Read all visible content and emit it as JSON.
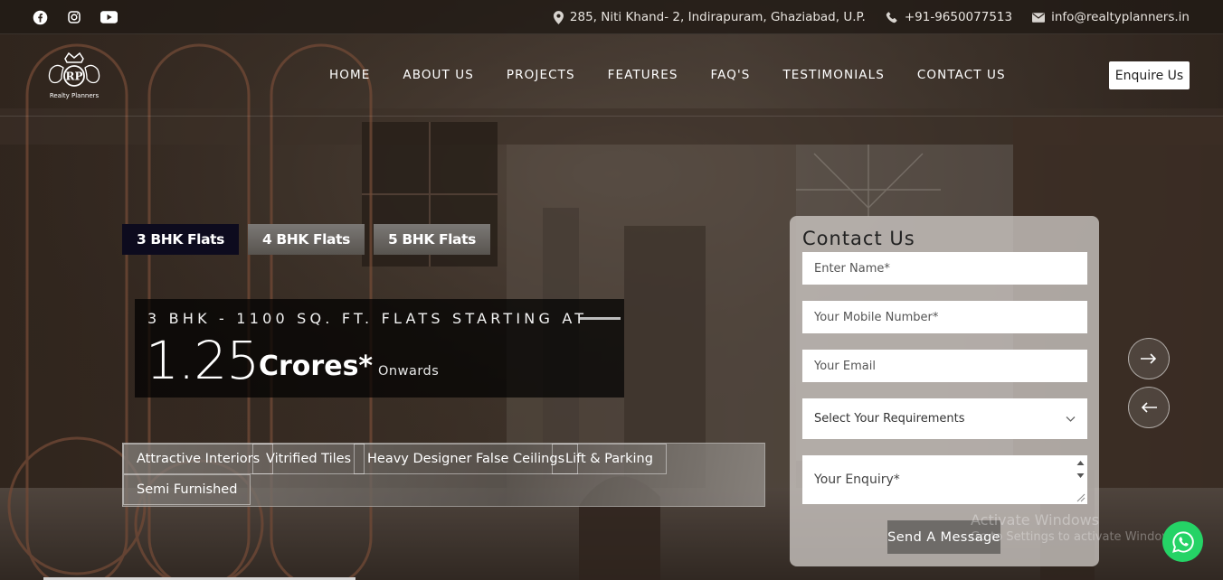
{
  "topbar": {
    "social": [
      "facebook-icon",
      "instagram-icon",
      "youtube-icon"
    ],
    "address": "285, Niti Khand- 2, Indirapuram, Ghaziabad, U.P.",
    "phone": "+91-9650077513",
    "email": "info@realtyplanners.in"
  },
  "logo": {
    "monogram": "RP",
    "name": "Realty Planners"
  },
  "nav": {
    "items": [
      "HOME",
      "ABOUT US",
      "PROJECTS",
      "FEATURES",
      "FAQ'S",
      "TESTIMONIALS",
      "CONTACT US"
    ],
    "cta": "Enquire Us"
  },
  "tabs": [
    {
      "label": "3 BHK Flats",
      "active": true
    },
    {
      "label": "4 BHK Flats",
      "active": false
    },
    {
      "label": "5 BHK Flats",
      "active": false
    }
  ],
  "headline": {
    "subtitle": "3 BHK - 1100 SQ. FT. FLATS STARTING AT",
    "price": "1.25",
    "unit": "Crores*",
    "suffix": "Onwards"
  },
  "features": [
    "Attractive Interiors",
    "Vitrified Tiles",
    "Heavy Designer False Ceilings",
    "Lift & Parking",
    "Semi Furnished"
  ],
  "form": {
    "title": "Contact Us",
    "name_placeholder": "Enter Name*",
    "mobile_placeholder": "Your Mobile Number*",
    "email_placeholder": "Your Email",
    "select_value": "Select Your Requirements",
    "enquiry_placeholder": "Your Enquiry*",
    "submit_label": "Send A Message"
  },
  "slider": {
    "next": "→",
    "prev": "←"
  },
  "watermark": {
    "title": "Activate Windows",
    "subtitle": "Go to Settings to activate Windows."
  },
  "colors": {
    "accent_dark": "#0d0b1e",
    "whatsapp": "#25d366",
    "overlay": "#2a211b"
  }
}
